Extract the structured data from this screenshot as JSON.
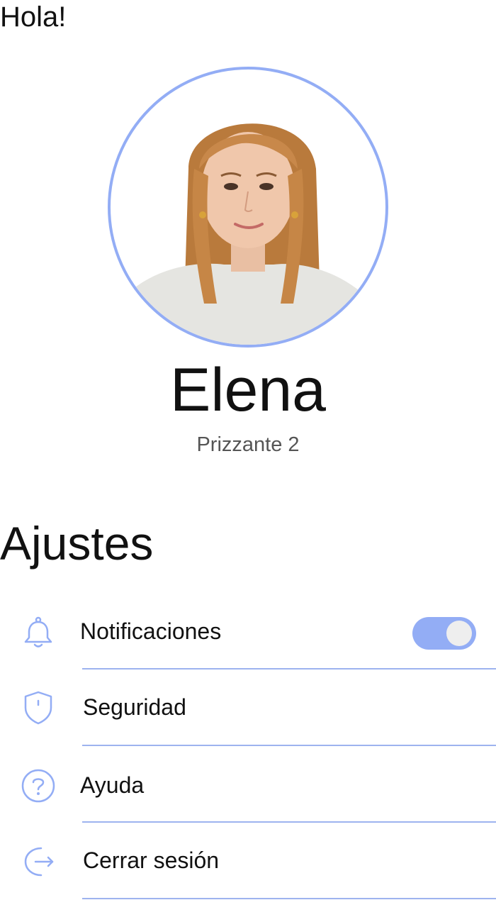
{
  "header": {
    "greeting": "Hola!"
  },
  "profile": {
    "name": "Elena",
    "subtitle": "Prizzante 2",
    "avatar_icon": "profile-photo",
    "ring_color": "#93adf5"
  },
  "settings": {
    "title": "Ajustes",
    "items": [
      {
        "label": "Notificaciones",
        "icon": "bell-icon",
        "toggle": true
      },
      {
        "label": "Seguridad",
        "icon": "shield-icon"
      },
      {
        "label": "Ayuda",
        "icon": "help-icon"
      },
      {
        "label": "Cerrar sesión",
        "icon": "logout-icon"
      }
    ]
  },
  "colors": {
    "accent": "#93adf5",
    "divider": "#9db3ef",
    "text": "#111111",
    "subtext": "#555555"
  }
}
